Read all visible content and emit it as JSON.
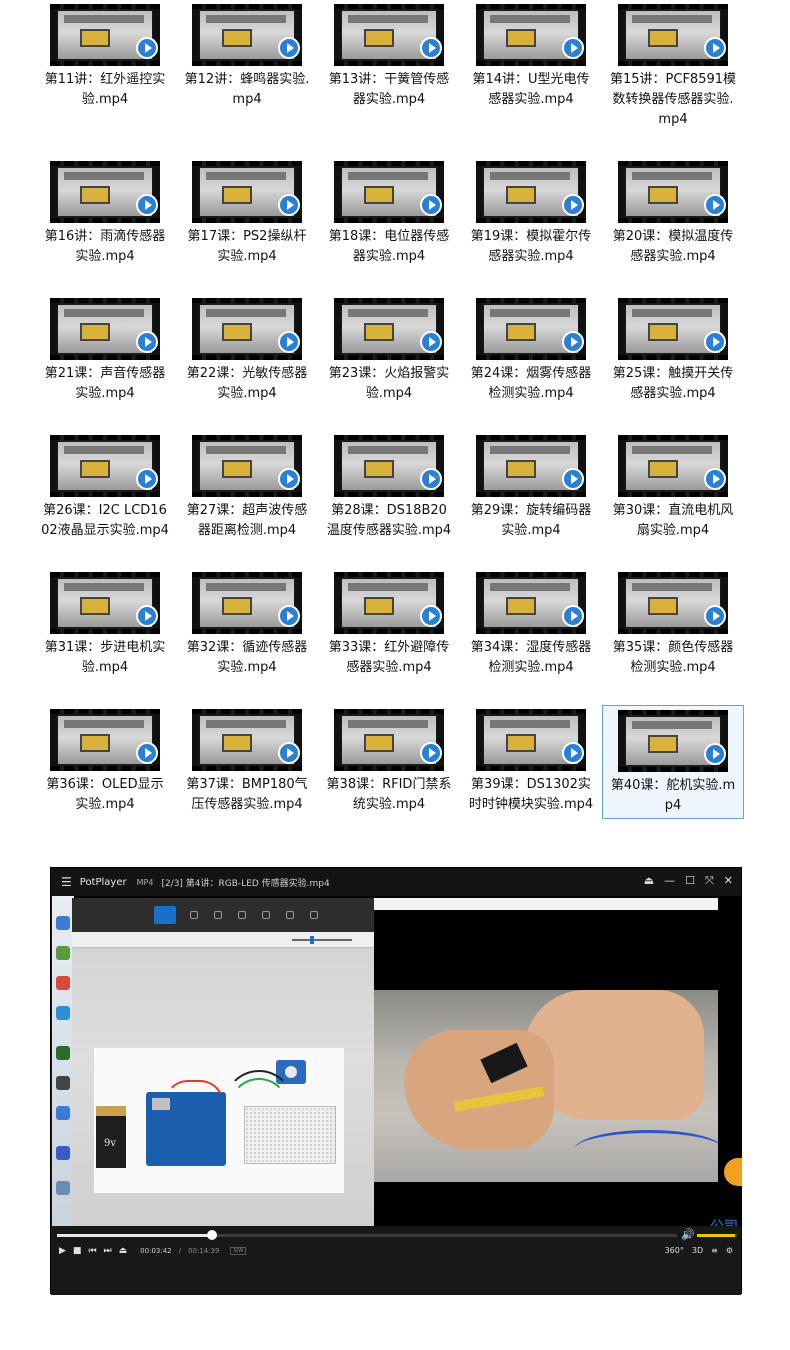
{
  "files": [
    {
      "label": "第11讲：红外遥控实验.mp4"
    },
    {
      "label": "第12讲：蜂鸣器实验.mp4"
    },
    {
      "label": "第13讲：干簧管传感器实验.mp4"
    },
    {
      "label": "第14讲：U型光电传感器实验.mp4"
    },
    {
      "label": "第15讲：PCF8591模数转换器传感器实验.mp4"
    },
    {
      "label": "第16讲：雨滴传感器实验.mp4"
    },
    {
      "label": "第17课：PS2操纵杆实验.mp4"
    },
    {
      "label": "第18课：电位器传感器实验.mp4"
    },
    {
      "label": "第19课：模拟霍尔传感器实验.mp4"
    },
    {
      "label": "第20课：模拟温度传感器实验.mp4"
    },
    {
      "label": "第21课：声音传感器实验.mp4"
    },
    {
      "label": "第22课：光敏传感器实验.mp4"
    },
    {
      "label": "第23课：火焰报警实验.mp4"
    },
    {
      "label": "第24课：烟雾传感器检测实验.mp4"
    },
    {
      "label": "第25课：触摸开关传感器实验.mp4"
    },
    {
      "label": "第26课：I2C LCD1602液晶显示实验.mp4"
    },
    {
      "label": "第27课：超声波传感器距离检测.mp4"
    },
    {
      "label": "第28课：DS18B20温度传感器实验.mp4"
    },
    {
      "label": "第29课：旋转编码器实验.mp4"
    },
    {
      "label": "第30课：直流电机风扇实验.mp4"
    },
    {
      "label": "第31课：步进电机实验.mp4"
    },
    {
      "label": "第32课：循迹传感器实验.mp4"
    },
    {
      "label": "第33课：红外避障传感器实验.mp4"
    },
    {
      "label": "第34课：湿度传感器检测实验.mp4"
    },
    {
      "label": "第35课：颜色传感器检测实验.mp4"
    },
    {
      "label": "第36课：OLED显示实验.mp4"
    },
    {
      "label": "第37课：BMP180气压传感器实验.mp4"
    },
    {
      "label": "第38课：RFID门禁系统实验.mp4"
    },
    {
      "label": "第39课：DS1302实时时钟模块实验.mp4"
    },
    {
      "label": "第40课：舵机实验.mp4"
    }
  ],
  "selected_index": 29,
  "player": {
    "app_name": "PotPlayer",
    "format": "MP4",
    "title": "[2/3] 第4讲：RGB-LED 传感器实验.mp4",
    "time_current": "00:03:42",
    "time_separator": "/",
    "time_total": "00:14:39",
    "codec": "S/W",
    "progress": 0.25,
    "volume": 0.95,
    "battery_label": "9v",
    "watermark_text": "公司",
    "right_controls": [
      "360°",
      "3D",
      "≡",
      "⚙"
    ]
  },
  "colors": {
    "accent": "#2a7fd6",
    "volume": "#f0c400",
    "selection_border": "#6aa0d8"
  }
}
